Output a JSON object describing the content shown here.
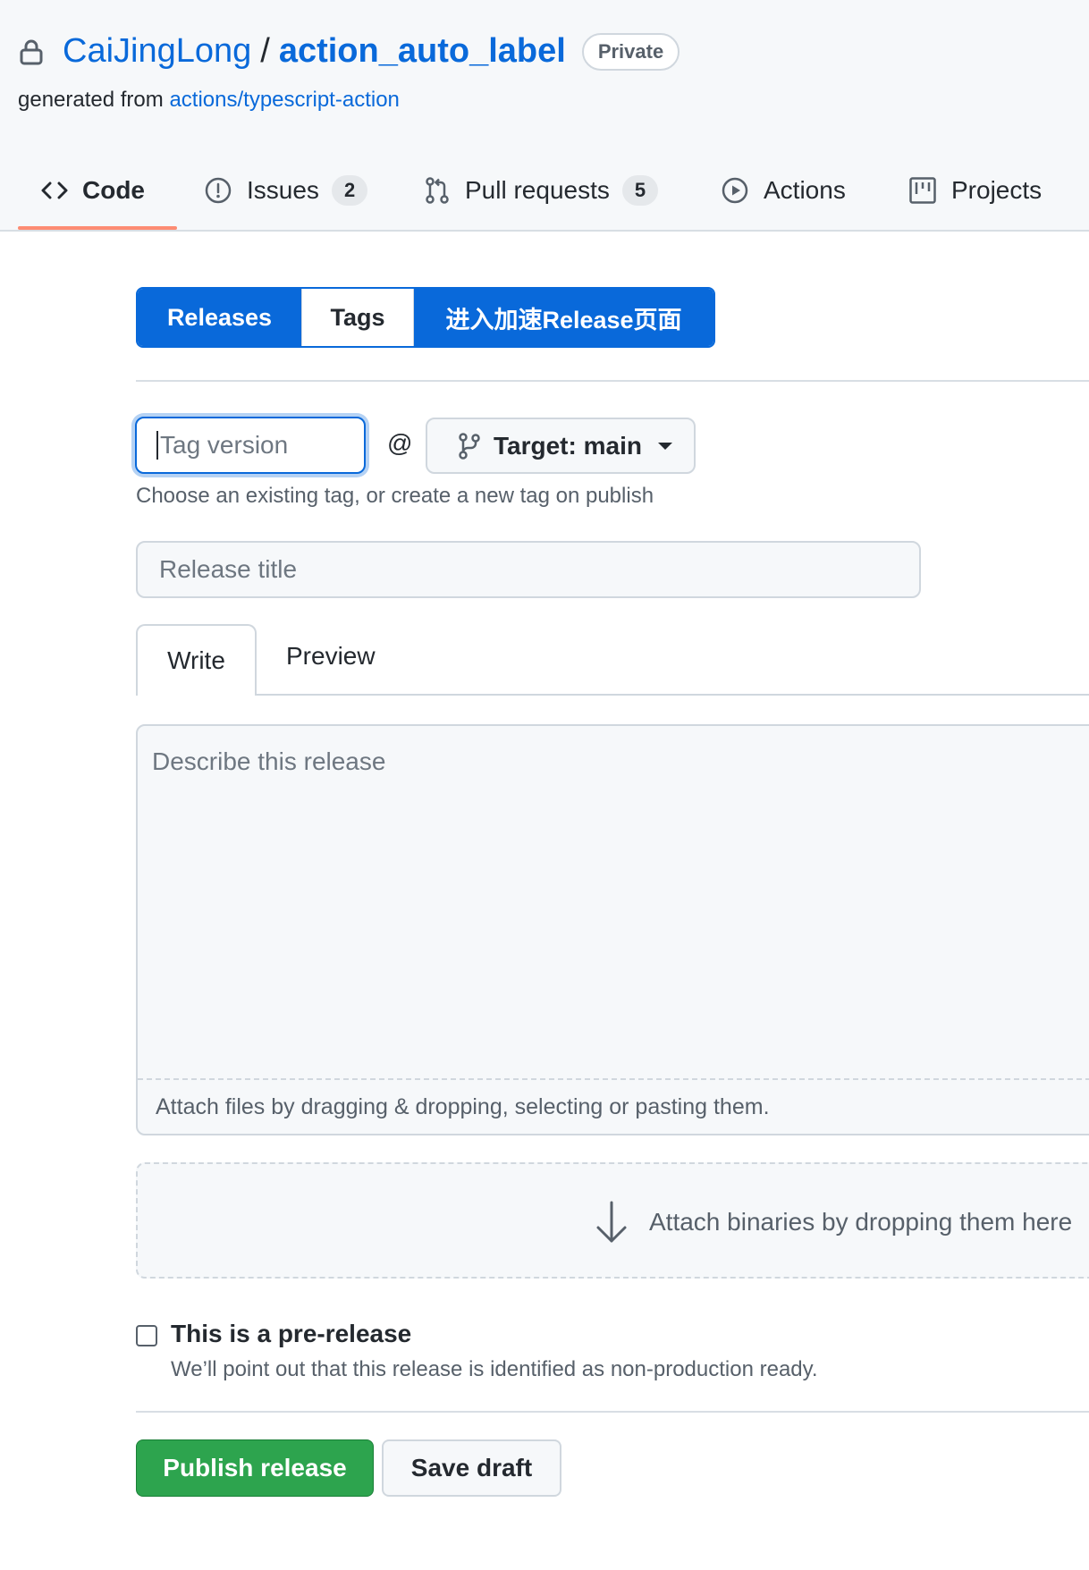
{
  "repo": {
    "owner": "CaiJingLong",
    "separator": "/",
    "name": "action_auto_label",
    "visibility": "Private",
    "generated_prefix": "generated from",
    "template_link": "actions/typescript-action"
  },
  "nav": {
    "tabs": [
      {
        "label": "Code",
        "icon": "code-icon",
        "selected": true
      },
      {
        "label": "Issues",
        "icon": "issue-icon",
        "count": "2"
      },
      {
        "label": "Pull requests",
        "icon": "pull-request-icon",
        "count": "5"
      },
      {
        "label": "Actions",
        "icon": "play-icon"
      },
      {
        "label": "Projects",
        "icon": "project-icon"
      }
    ]
  },
  "segments": {
    "releases": "Releases",
    "tags": "Tags",
    "accelerate": "进入加速Release页面"
  },
  "form": {
    "tag_placeholder": "Tag version",
    "at": "@",
    "target_label": "Target: main",
    "tag_helper": "Choose an existing tag, or create a new tag on publish",
    "title_placeholder": "Release title",
    "write_tab": "Write",
    "preview_tab": "Preview",
    "body_placeholder": "Describe this release",
    "attach_files": "Attach files by dragging & dropping, selecting or pasting them.",
    "attach_binaries": "Attach binaries by dropping them here",
    "prerelease_label": "This is a pre-release",
    "prerelease_note": "We’ll point out that this release is identified as non-production ready.",
    "prerelease_checked": false
  },
  "actions": {
    "publish": "Publish release",
    "save_draft": "Save draft"
  },
  "colors": {
    "accent": "#0969da",
    "publish": "#2da44e",
    "tab_underline": "#fd8c73"
  }
}
